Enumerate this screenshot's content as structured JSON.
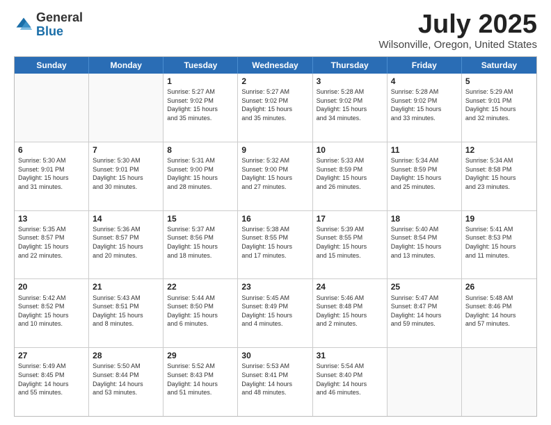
{
  "header": {
    "logo_general": "General",
    "logo_blue": "Blue",
    "month_title": "July 2025",
    "location": "Wilsonville, Oregon, United States"
  },
  "weekdays": [
    "Sunday",
    "Monday",
    "Tuesday",
    "Wednesday",
    "Thursday",
    "Friday",
    "Saturday"
  ],
  "weeks": [
    [
      {
        "day": "",
        "lines": []
      },
      {
        "day": "",
        "lines": []
      },
      {
        "day": "1",
        "lines": [
          "Sunrise: 5:27 AM",
          "Sunset: 9:02 PM",
          "Daylight: 15 hours",
          "and 35 minutes."
        ]
      },
      {
        "day": "2",
        "lines": [
          "Sunrise: 5:27 AM",
          "Sunset: 9:02 PM",
          "Daylight: 15 hours",
          "and 35 minutes."
        ]
      },
      {
        "day": "3",
        "lines": [
          "Sunrise: 5:28 AM",
          "Sunset: 9:02 PM",
          "Daylight: 15 hours",
          "and 34 minutes."
        ]
      },
      {
        "day": "4",
        "lines": [
          "Sunrise: 5:28 AM",
          "Sunset: 9:02 PM",
          "Daylight: 15 hours",
          "and 33 minutes."
        ]
      },
      {
        "day": "5",
        "lines": [
          "Sunrise: 5:29 AM",
          "Sunset: 9:01 PM",
          "Daylight: 15 hours",
          "and 32 minutes."
        ]
      }
    ],
    [
      {
        "day": "6",
        "lines": [
          "Sunrise: 5:30 AM",
          "Sunset: 9:01 PM",
          "Daylight: 15 hours",
          "and 31 minutes."
        ]
      },
      {
        "day": "7",
        "lines": [
          "Sunrise: 5:30 AM",
          "Sunset: 9:01 PM",
          "Daylight: 15 hours",
          "and 30 minutes."
        ]
      },
      {
        "day": "8",
        "lines": [
          "Sunrise: 5:31 AM",
          "Sunset: 9:00 PM",
          "Daylight: 15 hours",
          "and 28 minutes."
        ]
      },
      {
        "day": "9",
        "lines": [
          "Sunrise: 5:32 AM",
          "Sunset: 9:00 PM",
          "Daylight: 15 hours",
          "and 27 minutes."
        ]
      },
      {
        "day": "10",
        "lines": [
          "Sunrise: 5:33 AM",
          "Sunset: 8:59 PM",
          "Daylight: 15 hours",
          "and 26 minutes."
        ]
      },
      {
        "day": "11",
        "lines": [
          "Sunrise: 5:34 AM",
          "Sunset: 8:59 PM",
          "Daylight: 15 hours",
          "and 25 minutes."
        ]
      },
      {
        "day": "12",
        "lines": [
          "Sunrise: 5:34 AM",
          "Sunset: 8:58 PM",
          "Daylight: 15 hours",
          "and 23 minutes."
        ]
      }
    ],
    [
      {
        "day": "13",
        "lines": [
          "Sunrise: 5:35 AM",
          "Sunset: 8:57 PM",
          "Daylight: 15 hours",
          "and 22 minutes."
        ]
      },
      {
        "day": "14",
        "lines": [
          "Sunrise: 5:36 AM",
          "Sunset: 8:57 PM",
          "Daylight: 15 hours",
          "and 20 minutes."
        ]
      },
      {
        "day": "15",
        "lines": [
          "Sunrise: 5:37 AM",
          "Sunset: 8:56 PM",
          "Daylight: 15 hours",
          "and 18 minutes."
        ]
      },
      {
        "day": "16",
        "lines": [
          "Sunrise: 5:38 AM",
          "Sunset: 8:55 PM",
          "Daylight: 15 hours",
          "and 17 minutes."
        ]
      },
      {
        "day": "17",
        "lines": [
          "Sunrise: 5:39 AM",
          "Sunset: 8:55 PM",
          "Daylight: 15 hours",
          "and 15 minutes."
        ]
      },
      {
        "day": "18",
        "lines": [
          "Sunrise: 5:40 AM",
          "Sunset: 8:54 PM",
          "Daylight: 15 hours",
          "and 13 minutes."
        ]
      },
      {
        "day": "19",
        "lines": [
          "Sunrise: 5:41 AM",
          "Sunset: 8:53 PM",
          "Daylight: 15 hours",
          "and 11 minutes."
        ]
      }
    ],
    [
      {
        "day": "20",
        "lines": [
          "Sunrise: 5:42 AM",
          "Sunset: 8:52 PM",
          "Daylight: 15 hours",
          "and 10 minutes."
        ]
      },
      {
        "day": "21",
        "lines": [
          "Sunrise: 5:43 AM",
          "Sunset: 8:51 PM",
          "Daylight: 15 hours",
          "and 8 minutes."
        ]
      },
      {
        "day": "22",
        "lines": [
          "Sunrise: 5:44 AM",
          "Sunset: 8:50 PM",
          "Daylight: 15 hours",
          "and 6 minutes."
        ]
      },
      {
        "day": "23",
        "lines": [
          "Sunrise: 5:45 AM",
          "Sunset: 8:49 PM",
          "Daylight: 15 hours",
          "and 4 minutes."
        ]
      },
      {
        "day": "24",
        "lines": [
          "Sunrise: 5:46 AM",
          "Sunset: 8:48 PM",
          "Daylight: 15 hours",
          "and 2 minutes."
        ]
      },
      {
        "day": "25",
        "lines": [
          "Sunrise: 5:47 AM",
          "Sunset: 8:47 PM",
          "Daylight: 14 hours",
          "and 59 minutes."
        ]
      },
      {
        "day": "26",
        "lines": [
          "Sunrise: 5:48 AM",
          "Sunset: 8:46 PM",
          "Daylight: 14 hours",
          "and 57 minutes."
        ]
      }
    ],
    [
      {
        "day": "27",
        "lines": [
          "Sunrise: 5:49 AM",
          "Sunset: 8:45 PM",
          "Daylight: 14 hours",
          "and 55 minutes."
        ]
      },
      {
        "day": "28",
        "lines": [
          "Sunrise: 5:50 AM",
          "Sunset: 8:44 PM",
          "Daylight: 14 hours",
          "and 53 minutes."
        ]
      },
      {
        "day": "29",
        "lines": [
          "Sunrise: 5:52 AM",
          "Sunset: 8:43 PM",
          "Daylight: 14 hours",
          "and 51 minutes."
        ]
      },
      {
        "day": "30",
        "lines": [
          "Sunrise: 5:53 AM",
          "Sunset: 8:41 PM",
          "Daylight: 14 hours",
          "and 48 minutes."
        ]
      },
      {
        "day": "31",
        "lines": [
          "Sunrise: 5:54 AM",
          "Sunset: 8:40 PM",
          "Daylight: 14 hours",
          "and 46 minutes."
        ]
      },
      {
        "day": "",
        "lines": []
      },
      {
        "day": "",
        "lines": []
      }
    ]
  ]
}
